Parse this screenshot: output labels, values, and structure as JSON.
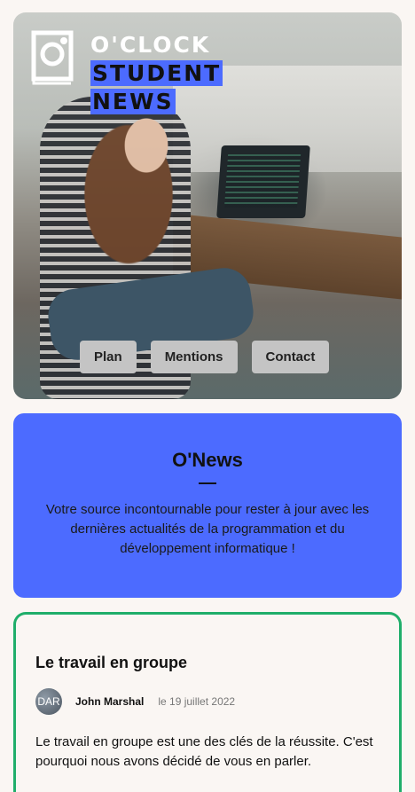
{
  "header": {
    "logo": {
      "icon": "clock-logo-icon",
      "line1_plain": "O'CLOCK",
      "line1_highlight": "STUDENT",
      "line2_highlight": "NEWS"
    },
    "nav": [
      {
        "label": "Plan"
      },
      {
        "label": "Mentions"
      },
      {
        "label": "Contact"
      }
    ]
  },
  "intro": {
    "title": "O'News",
    "text": "Votre source incontournable pour rester à jour avec les dernières actualités de la programmation et du développement informatique !"
  },
  "article": {
    "title": "Le travail en groupe",
    "author": "John Marshal",
    "avatar_initials": "DAR",
    "date": "le 19 juillet 2022",
    "excerpt": "Le travail en groupe est une des clés de la réussite. C'est pourquoi nous avons décidé de vous en parler."
  },
  "colors": {
    "accent": "#4c6bff",
    "article_border": "#1fae6a",
    "nav_button": "#c4c4c4",
    "background": "#faf6f3"
  }
}
